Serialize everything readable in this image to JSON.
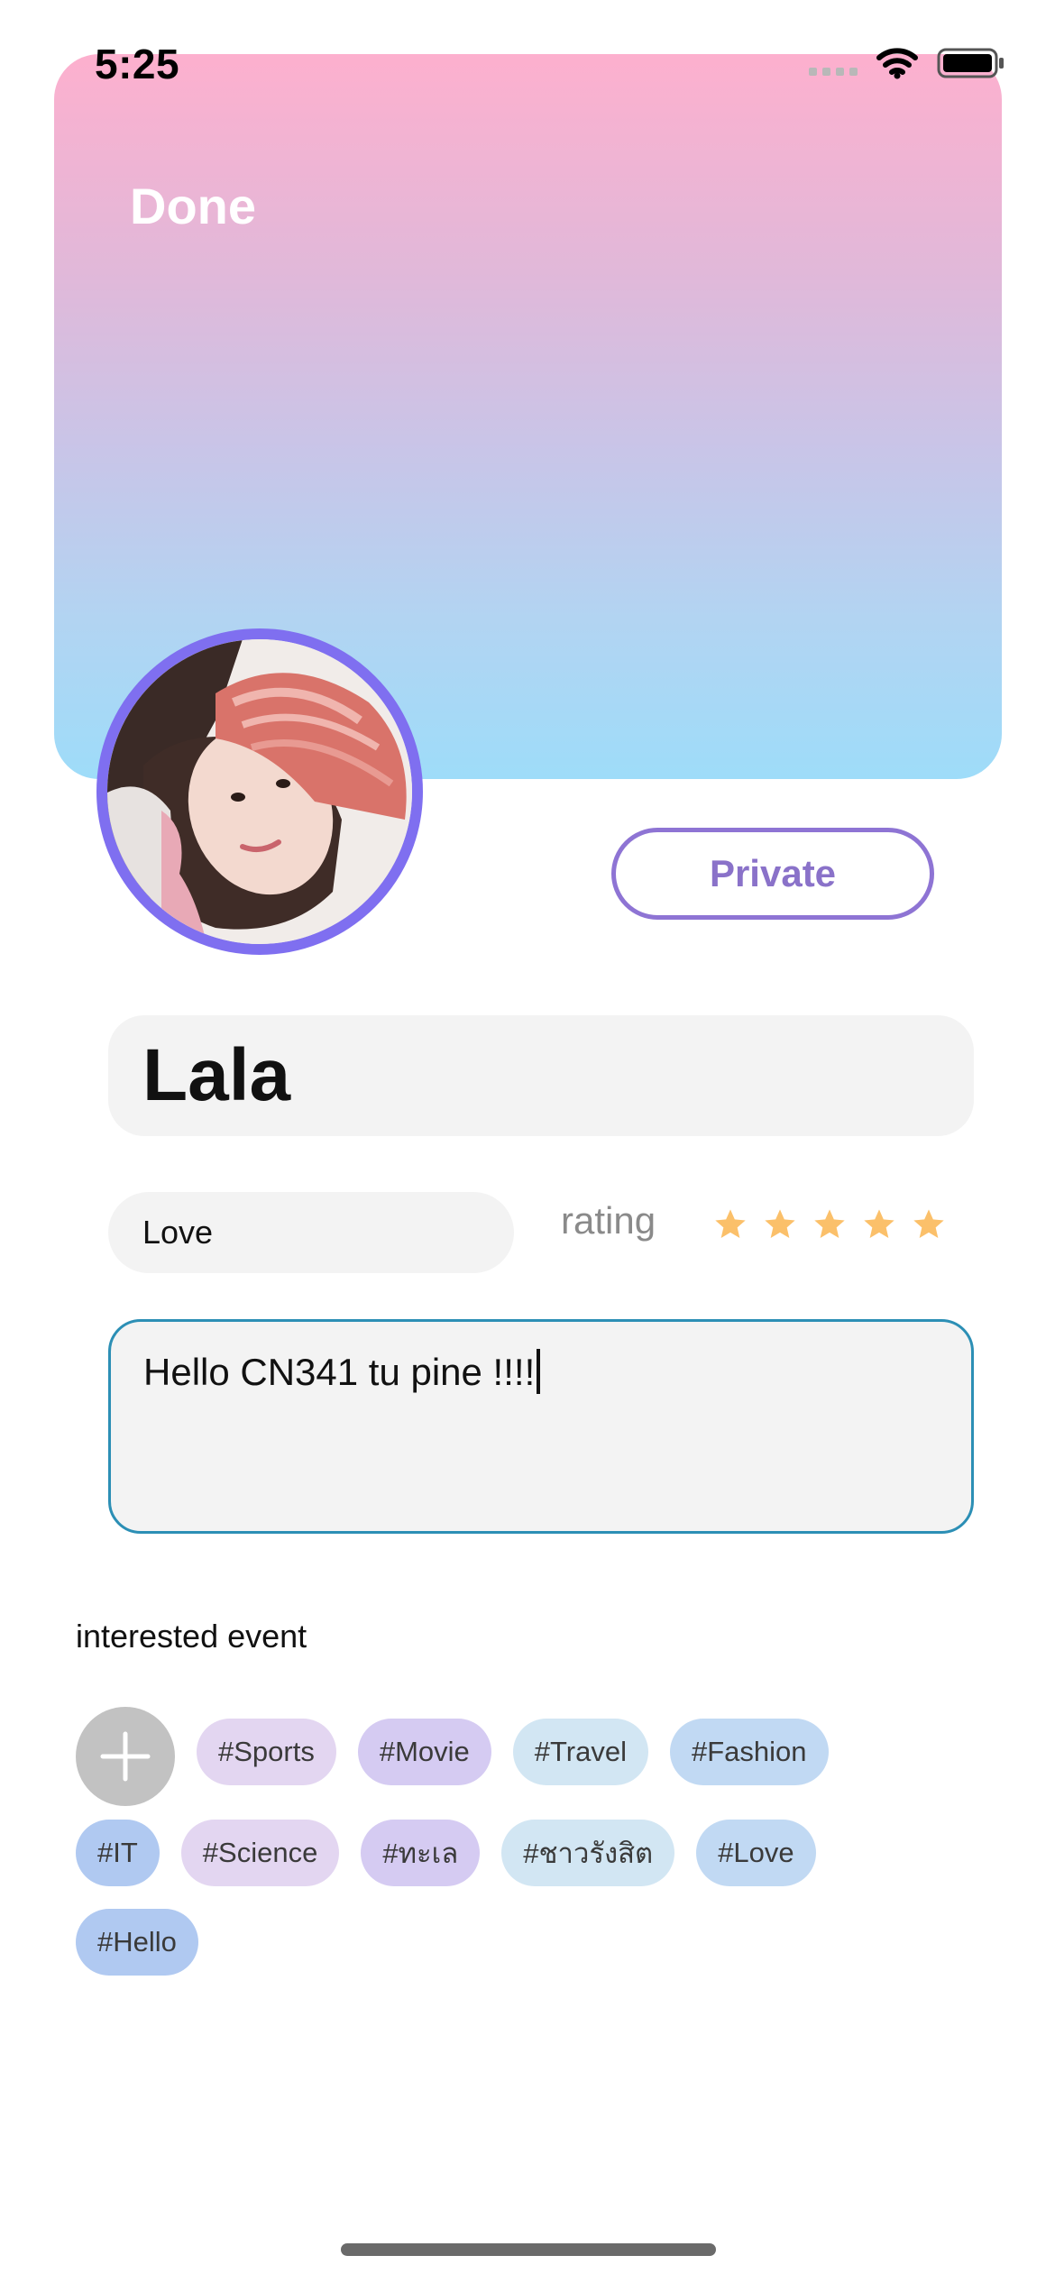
{
  "status_bar": {
    "time": "5:25"
  },
  "header": {
    "done_label": "Done"
  },
  "profile": {
    "privacy_label": "Private",
    "name": "Lala",
    "mood": "Love",
    "rating_label": "rating",
    "rating_value": 5,
    "rating_max": 5,
    "bio": "Hello CN341 tu pine !!!!"
  },
  "interests": {
    "section_label": "interested event",
    "tags": [
      "#Sports",
      "#Movie",
      "#Travel",
      "#Fashion",
      "#IT",
      "#Science",
      "#ทะเล",
      "#ชาวรังสิต",
      "#Love",
      "#Hello"
    ]
  },
  "colors": {
    "accent": "#7f6ff0",
    "private_border": "#8e74d4",
    "star": "#fbc06a",
    "bio_border": "#2c8fb5",
    "gradient_top": "#fdb0ce",
    "gradient_bottom": "#9edcf9"
  }
}
